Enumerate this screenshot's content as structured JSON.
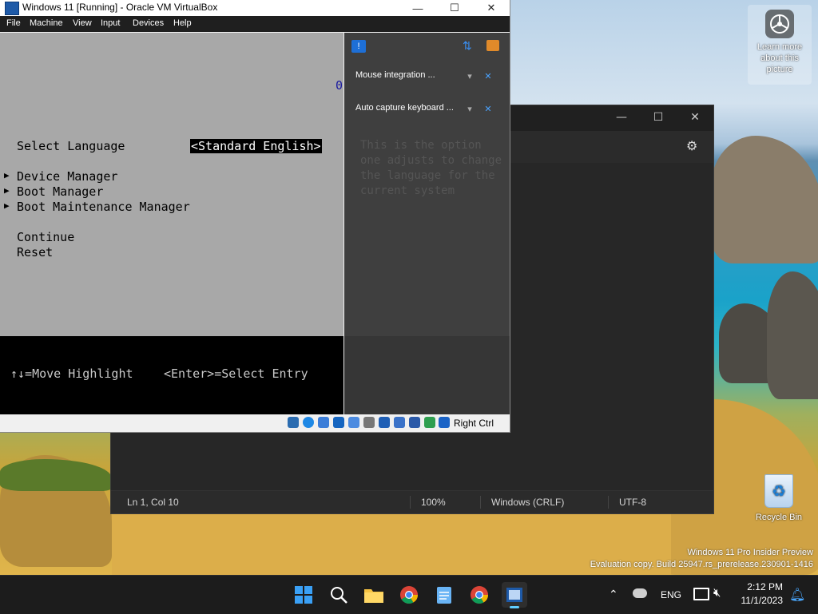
{
  "desktop": {
    "learn_more_label": "Learn more about this picture",
    "recycle_bin_label": "Recycle Bin",
    "watermark_line1": "Windows 11 Pro Insider Preview",
    "watermark_line2": "Evaluation copy. Build 25947.rs_prerelease.230901-1416"
  },
  "vbox": {
    "title": "Windows 11 [Running] - Oracle VM VirtualBox",
    "menu": [
      "File",
      "Machine",
      "View",
      "Input",
      "Devices",
      "Help"
    ],
    "host_key_label": "Right Ctrl",
    "bios": {
      "top_fragment": "0",
      "select_language_label": "Select Language",
      "select_language_value": "<Standard English>",
      "items": [
        "Device Manager",
        "Boot Manager",
        "Boot Maintenance Manager"
      ],
      "continue_label": "Continue",
      "reset_label": "Reset",
      "footer_move": "↑↓=Move Highlight",
      "footer_enter": "<Enter>=Select Entry"
    },
    "notifications": {
      "mouse_integration": "Mouse integration ...",
      "auto_capture": "Auto capture keyboard ...",
      "help_text": "This is the option one adjusts to change the language for the current system"
    }
  },
  "notepad": {
    "status_position": "Ln 1, Col 10",
    "status_zoom": "100%",
    "status_line_ending": "Windows (CRLF)",
    "status_encoding": "UTF-8"
  },
  "taskbar": {
    "language": "ENG",
    "time": "2:12 PM",
    "date": "11/1/2023"
  },
  "colors": {
    "taskbar_bg": "#1c1c1c",
    "bios_bg": "#a8a8a8",
    "notify_bg": "#3f3f3f",
    "notepad_bg": "#272727"
  }
}
